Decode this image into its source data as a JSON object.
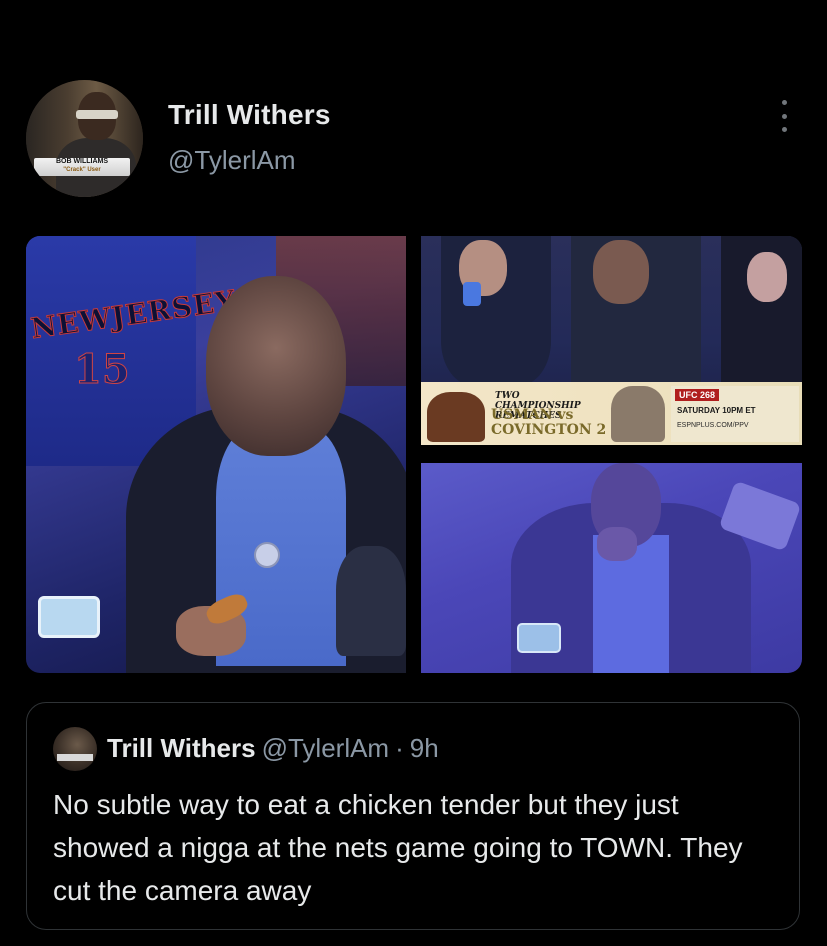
{
  "tweet": {
    "author": {
      "display_name": "Trill Withers",
      "handle": "@TylerlAm",
      "avatar_caption_line1": "BOB WILLIAMS",
      "avatar_caption_line2": "\"Crack\" User"
    },
    "more_icon": "more-horizontal-icon",
    "media": [
      {
        "jersey_text": "NEWJERSEY",
        "jersey_number": "15"
      },
      {
        "banner_headline": "TWO CHAMPIONSHIP REMATCHES",
        "banner_line1": "USMAN vs",
        "banner_line2": "COVINGTON 2",
        "banner_brand": "UFC 268",
        "banner_date": "SATURDAY 10PM ET",
        "banner_url": "ESPNPLUS.COM/PPV"
      },
      {}
    ]
  },
  "quoted_tweet": {
    "display_name": "Trill Withers",
    "handle": "@TylerlAm",
    "separator": "·",
    "time": "9h",
    "text": "No subtle way to eat a chicken tender but they just showed a nigga at the nets game going to TOWN. They cut the camera away"
  },
  "colors": {
    "background": "#000000",
    "primary_text": "#e7e9ea",
    "secondary_text": "#8b98a5",
    "border": "#2f3336"
  }
}
